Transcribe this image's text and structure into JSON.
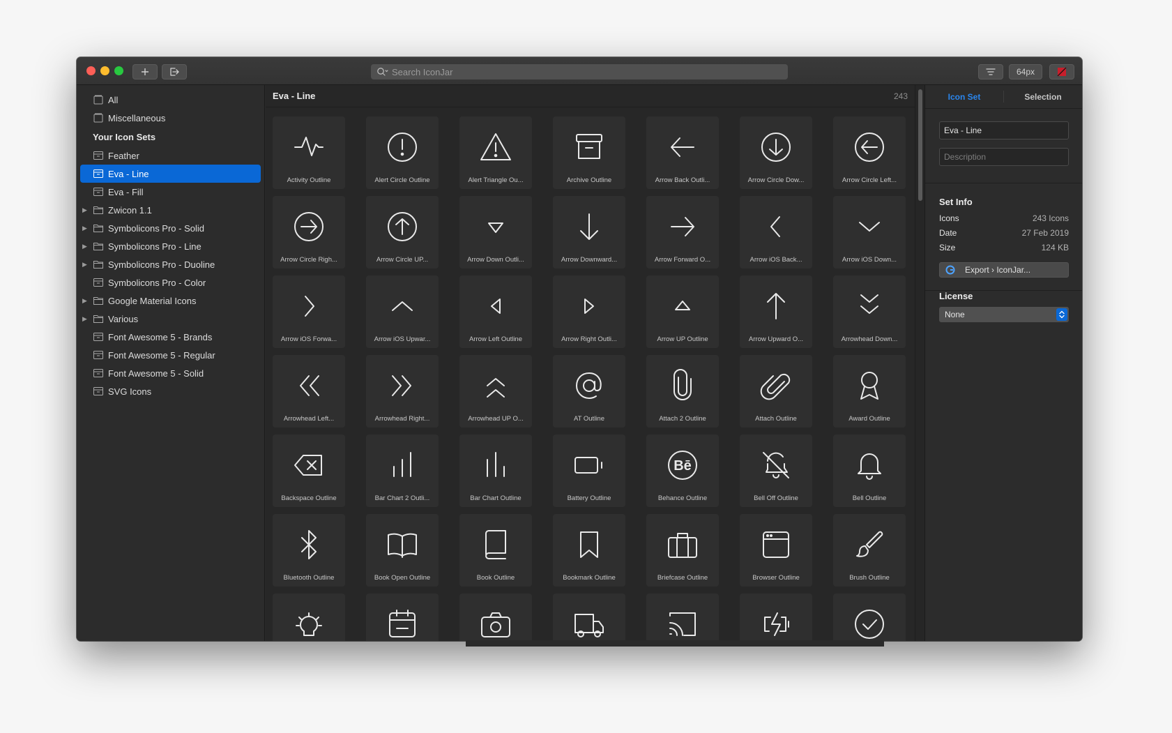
{
  "toolbar": {
    "search_placeholder": "Search IconJar",
    "size_label": "64px"
  },
  "sidebar": {
    "top_items": [
      {
        "label": "All"
      },
      {
        "label": "Miscellaneous"
      }
    ],
    "section_title": "Your Icon Sets",
    "sets": [
      {
        "label": "Feather",
        "kind": "set"
      },
      {
        "label": "Eva - Line",
        "kind": "set",
        "selected": true
      },
      {
        "label": "Eva - Fill",
        "kind": "set"
      },
      {
        "label": "Zwicon 1.1",
        "kind": "group"
      },
      {
        "label": "Symbolicons Pro - Solid",
        "kind": "group"
      },
      {
        "label": "Symbolicons Pro - Line",
        "kind": "group"
      },
      {
        "label": "Symbolicons Pro - Duoline",
        "kind": "group"
      },
      {
        "label": "Symbolicons Pro - Color",
        "kind": "set"
      },
      {
        "label": "Google Material Icons",
        "kind": "group"
      },
      {
        "label": "Various",
        "kind": "group"
      },
      {
        "label": "Font Awesome 5 - Brands",
        "kind": "set"
      },
      {
        "label": "Font Awesome 5 - Regular",
        "kind": "set"
      },
      {
        "label": "Font Awesome 5 - Solid",
        "kind": "set"
      },
      {
        "label": "SVG Icons",
        "kind": "set"
      }
    ]
  },
  "main": {
    "title": "Eva - Line",
    "count": "243",
    "icons": [
      {
        "label": "Activity Outline",
        "icon": "activity-outline-icon"
      },
      {
        "label": "Alert Circle Outline",
        "icon": "alert-circle-outline-icon"
      },
      {
        "label": "Alert Triangle Ou...",
        "icon": "alert-triangle-outline-icon"
      },
      {
        "label": "Archive Outline",
        "icon": "archive-outline-icon"
      },
      {
        "label": "Arrow Back Outli...",
        "icon": "arrow-back-outline-icon"
      },
      {
        "label": "Arrow Circle Dow...",
        "icon": "arrow-circle-down-outline-icon"
      },
      {
        "label": "Arrow Circle Left...",
        "icon": "arrow-circle-left-outline-icon"
      },
      {
        "label": "Arrow Circle Righ...",
        "icon": "arrow-circle-right-outline-icon"
      },
      {
        "label": "Arrow Circle UP...",
        "icon": "arrow-circle-up-outline-icon"
      },
      {
        "label": "Arrow Down Outli...",
        "icon": "arrow-down-outline-icon"
      },
      {
        "label": "Arrow Downward...",
        "icon": "arrow-downward-outline-icon"
      },
      {
        "label": "Arrow Forward O...",
        "icon": "arrow-forward-outline-icon"
      },
      {
        "label": "Arrow iOS Back...",
        "icon": "arrow-ios-back-outline-icon"
      },
      {
        "label": "Arrow iOS Down...",
        "icon": "arrow-ios-down-outline-icon"
      },
      {
        "label": "Arrow iOS Forwa...",
        "icon": "arrow-ios-forward-outline-icon"
      },
      {
        "label": "Arrow iOS Upwar...",
        "icon": "arrow-ios-upward-outline-icon"
      },
      {
        "label": "Arrow Left Outline",
        "icon": "arrow-left-outline-icon"
      },
      {
        "label": "Arrow Right Outli...",
        "icon": "arrow-right-outline-icon"
      },
      {
        "label": "Arrow UP Outline",
        "icon": "arrow-up-outline-icon"
      },
      {
        "label": "Arrow Upward O...",
        "icon": "arrow-upward-outline-icon"
      },
      {
        "label": "Arrowhead Down...",
        "icon": "arrowhead-down-outline-icon"
      },
      {
        "label": "Arrowhead Left...",
        "icon": "arrowhead-left-outline-icon"
      },
      {
        "label": "Arrowhead Right...",
        "icon": "arrowhead-right-outline-icon"
      },
      {
        "label": "Arrowhead UP O...",
        "icon": "arrowhead-up-outline-icon"
      },
      {
        "label": "AT Outline",
        "icon": "at-outline-icon"
      },
      {
        "label": "Attach 2 Outline",
        "icon": "attach-2-outline-icon"
      },
      {
        "label": "Attach Outline",
        "icon": "attach-outline-icon"
      },
      {
        "label": "Award Outline",
        "icon": "award-outline-icon"
      },
      {
        "label": "Backspace Outline",
        "icon": "backspace-outline-icon"
      },
      {
        "label": "Bar Chart 2 Outli...",
        "icon": "bar-chart-2-outline-icon"
      },
      {
        "label": "Bar Chart Outline",
        "icon": "bar-chart-outline-icon"
      },
      {
        "label": "Battery Outline",
        "icon": "battery-outline-icon"
      },
      {
        "label": "Behance Outline",
        "icon": "behance-outline-icon"
      },
      {
        "label": "Bell Off Outline",
        "icon": "bell-off-outline-icon"
      },
      {
        "label": "Bell Outline",
        "icon": "bell-outline-icon"
      },
      {
        "label": "Bluetooth Outline",
        "icon": "bluetooth-outline-icon"
      },
      {
        "label": "Book Open Outline",
        "icon": "book-open-outline-icon"
      },
      {
        "label": "Book Outline",
        "icon": "book-outline-icon"
      },
      {
        "label": "Bookmark Outline",
        "icon": "bookmark-outline-icon"
      },
      {
        "label": "Briefcase Outline",
        "icon": "briefcase-outline-icon"
      },
      {
        "label": "Browser Outline",
        "icon": "browser-outline-icon"
      },
      {
        "label": "Brush Outline",
        "icon": "brush-outline-icon"
      },
      {
        "label": "",
        "icon": "bulb-outline-icon"
      },
      {
        "label": "",
        "icon": "calendar-outline-icon"
      },
      {
        "label": "",
        "icon": "camera-outline-icon"
      },
      {
        "label": "",
        "icon": "car-outline-icon"
      },
      {
        "label": "",
        "icon": "cast-outline-icon"
      },
      {
        "label": "",
        "icon": "charging-outline-icon"
      },
      {
        "label": "",
        "icon": "checkmark-circle-outline-icon"
      }
    ]
  },
  "inspector": {
    "tabs": [
      {
        "label": "Icon Set",
        "active": true
      },
      {
        "label": "Selection",
        "active": false
      }
    ],
    "name_value": "Eva - Line",
    "description_placeholder": "Description",
    "set_info_title": "Set Info",
    "info": [
      {
        "key": "Icons",
        "value": "243 Icons"
      },
      {
        "key": "Date",
        "value": "27 Feb 2019"
      },
      {
        "key": "Size",
        "value": "124 KB"
      }
    ],
    "export_label": "Export › IconJar...",
    "license_title": "License",
    "license_value": "None"
  },
  "colors": {
    "accent": "#0a68d6",
    "active_tab": "#2a86ee",
    "window_bg": "#2a2a2a"
  }
}
